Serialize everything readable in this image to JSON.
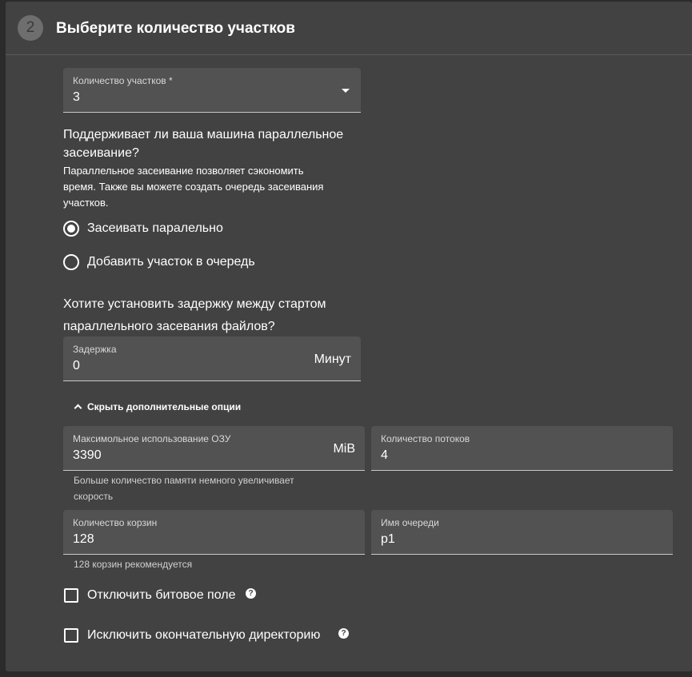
{
  "step": {
    "number": "2",
    "title": "Выберите количество участков"
  },
  "plot_count": {
    "label": "Количество участков *",
    "value": "3"
  },
  "parallel": {
    "question_line1": "Поддерживает ли ваша машина параллельное",
    "question_line2": "засеивание?",
    "description_line1": "Параллельное засеивание позволяет сэкономить",
    "description_line2": "время. Также вы можете создать очередь засеивания",
    "description_line3": "участков.",
    "options": [
      {
        "label": "Засеивать паралельно",
        "selected": true
      },
      {
        "label": "Добавить участок в очередь",
        "selected": false
      }
    ]
  },
  "delay": {
    "question_line1": "Хотите установить задержку между стартом",
    "question_line2": "параллельного засевания файлов?",
    "label": "Задержка",
    "value": "0",
    "unit": "Минут"
  },
  "advanced_toggle": {
    "label": "Скрыть дополнительные опции"
  },
  "ram": {
    "label": "Максимольное использование ОЗУ",
    "value": "3390",
    "unit": "MiB",
    "hint_line1": "Больше количество памяти немного увеличивает",
    "hint_line2": "скорость"
  },
  "threads": {
    "label": "Количество потоков",
    "value": "4"
  },
  "buckets": {
    "label": "Количество корзин",
    "value": "128",
    "hint": "128 корзин рекомендуется"
  },
  "queue_name": {
    "label": "Имя очереди",
    "value": "p1"
  },
  "checkboxes": [
    {
      "label": "Отключить битовое поле",
      "checked": false
    },
    {
      "label": "Исключить окончательную директорию",
      "checked": false
    }
  ],
  "help_glyph": "?"
}
